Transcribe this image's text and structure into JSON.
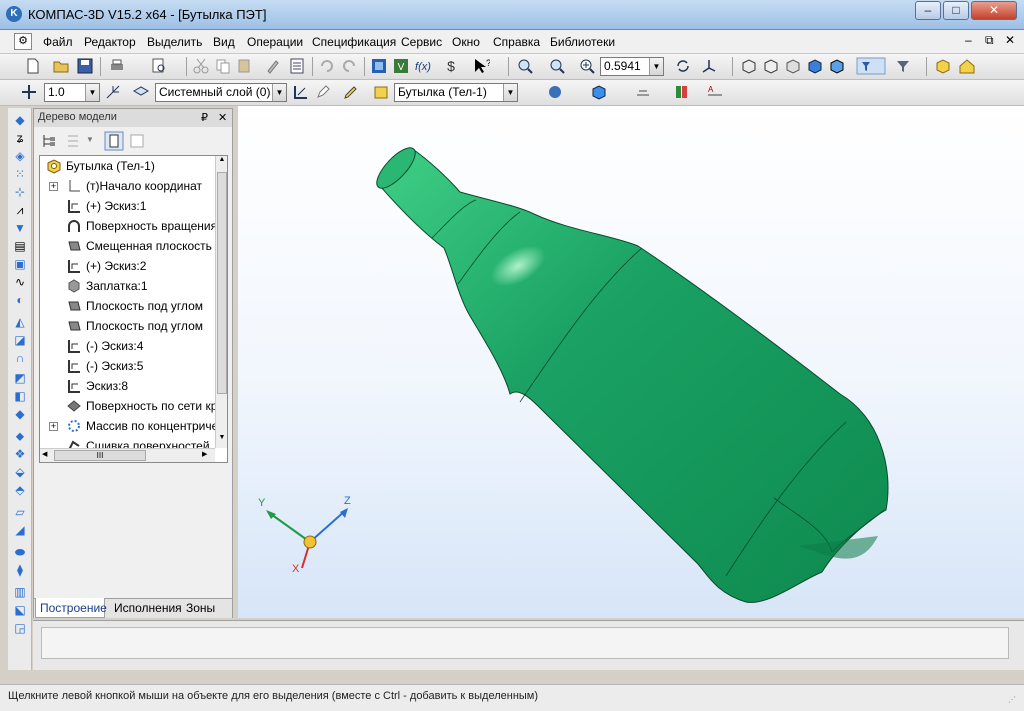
{
  "window": {
    "title": "КОМПАС-3D V15.2  x64 - [Бутылка ПЭТ]",
    "minimize_glyph": "–",
    "maximize_glyph": "□",
    "close_glyph": "✕"
  },
  "menubar": {
    "items": [
      "Файл",
      "Редактор",
      "Выделить",
      "Вид",
      "Операции",
      "Спецификация",
      "Сервис",
      "Окно",
      "Справка",
      "Библиотеки"
    ],
    "doc_minimize": "–",
    "doc_restore": "⧉",
    "doc_close": "✕"
  },
  "toolbar1": {
    "zoom_value": "0.5941"
  },
  "toolbar2": {
    "step_value": "1.0",
    "layer_value": "Системный слой (0)",
    "body_value": "Бутылка (Тел-1)"
  },
  "tree_panel": {
    "title": "Дерево модели",
    "pin_glyph": "₽",
    "close_glyph": "✕",
    "rows": [
      {
        "label": "Бутылка (Тел-1)",
        "icon": "part-icon"
      },
      {
        "label": "(т)Начало координат",
        "icon": "origin-icon"
      },
      {
        "label": "(+) Эскиз:1",
        "icon": "sketch-icon"
      },
      {
        "label": "Поверхность вращения",
        "icon": "revolve-surface-icon"
      },
      {
        "label": "Смещенная плоскость",
        "icon": "plane-icon"
      },
      {
        "label": "(+) Эскиз:2",
        "icon": "sketch-icon"
      },
      {
        "label": "Заплатка:1",
        "icon": "patch-icon"
      },
      {
        "label": "Плоскость под углом",
        "icon": "plane-icon"
      },
      {
        "label": "Плоскость под углом",
        "icon": "plane-icon"
      },
      {
        "label": "(-) Эскиз:4",
        "icon": "sketch-icon"
      },
      {
        "label": "(-) Эскиз:5",
        "icon": "sketch-icon"
      },
      {
        "label": "Эскиз:8",
        "icon": "sketch-icon"
      },
      {
        "label": "Поверхность по сети кривых",
        "icon": "mesh-surface-icon"
      },
      {
        "label": "Массив по концентрической сетке",
        "icon": "circular-array-icon"
      },
      {
        "label": "Сшивка поверхностей",
        "icon": "stitch-icon"
      }
    ],
    "hscroll_glyph": "III",
    "tabs": [
      "Построение",
      "Исполнения",
      "Зоны"
    ]
  },
  "triad": {
    "x_label": "X",
    "y_label": "Y",
    "z_label": "Z"
  },
  "status": {
    "hint": "Щелкните левой кнопкой мыши на объекте для его выделения (вместе с Ctrl - добавить к выделенным)"
  },
  "colors": {
    "model_green": "#1aa163",
    "model_edge": "#0a4a2a",
    "viewport_top": "#ffffff",
    "viewport_bottom": "#d6e5f8"
  }
}
